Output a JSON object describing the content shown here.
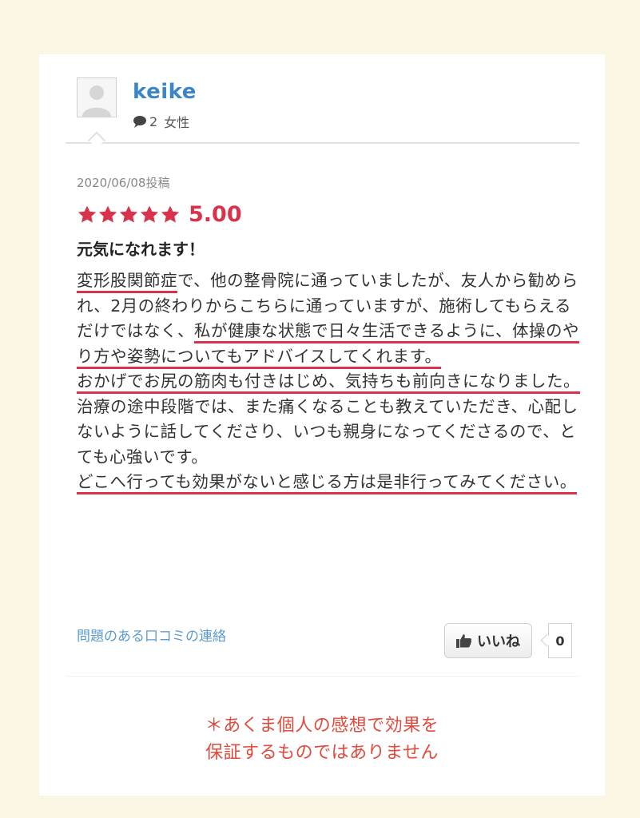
{
  "user": {
    "name": "keike",
    "review_count": "2",
    "gender": "女性"
  },
  "review": {
    "date": "2020/06/08投稿",
    "rating": "5.00",
    "stars_filled": 5,
    "title": "元気になれます！",
    "body": {
      "l1_ul": "変形股関節症",
      "l1_rest": "で、他の整骨院に通っていましたが、友人から勧められ、2月の終わりからこちらに通っていますが、施術してもらえるだけではなく、",
      "l2_ul": "私が健康な状態で日々生活できるように、体操のやり方や姿勢についてもアドバイスしてくれます。",
      "l3_ul": "おかげでお尻の筋肉も付きはじめ、気持ちも前向きになりました。",
      "l4": "治療の途中段階では、また痛くなることも教えていただき、心配しないように話してくださり、いつも親身になってくださるので、とても心強いです。",
      "l5_ul": "どこへ行っても効果がないと感じる方は是非行ってみてください。"
    }
  },
  "actions": {
    "report_label": "問題のある口コミの連絡",
    "like_label": "いいね",
    "like_count": "0"
  },
  "disclaimer": {
    "line1": "＊あくま個人の感想で効果を",
    "line2": "保証するものではありません"
  },
  "colors": {
    "background": "#fbf6e3",
    "accent_red": "#d9324b",
    "username_blue": "#3a86c8",
    "link_blue": "#5b9bd0",
    "disclaimer_red": "#e24a3b"
  },
  "icons": [
    "avatar-placeholder-icon",
    "comment-bubble-icon",
    "star-icon",
    "thumbs-up-icon"
  ]
}
